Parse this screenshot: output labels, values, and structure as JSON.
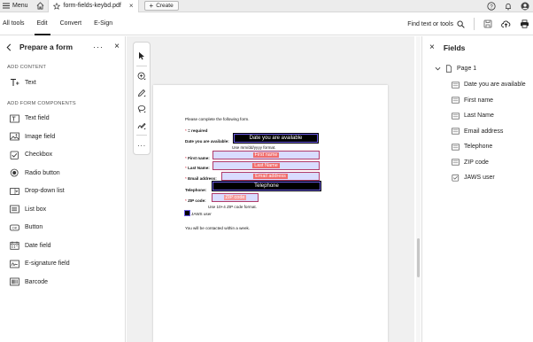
{
  "tabbar": {
    "menu_label": "Menu",
    "doc_tab_name": "form-fields-keybd.pdf",
    "create_label": "Create"
  },
  "toolbar": {
    "tabs": [
      {
        "label": "All tools",
        "active": false
      },
      {
        "label": "Edit",
        "active": true
      },
      {
        "label": "Convert",
        "active": false
      },
      {
        "label": "E-Sign",
        "active": false
      }
    ],
    "find_label": "Find text or tools"
  },
  "left_panel": {
    "title": "Prepare a form",
    "add_content_heading": "ADD CONTENT",
    "add_content_items": [
      {
        "label": "Text",
        "icon": "text-icon"
      }
    ],
    "components_heading": "ADD FORM COMPONENTS",
    "components": [
      {
        "label": "Text field",
        "icon": "text-field-icon"
      },
      {
        "label": "Image field",
        "icon": "image-field-icon"
      },
      {
        "label": "Checkbox",
        "icon": "checkbox-icon"
      },
      {
        "label": "Radio button",
        "icon": "radio-button-icon"
      },
      {
        "label": "Drop-down list",
        "icon": "dropdown-list-icon"
      },
      {
        "label": "List box",
        "icon": "list-box-icon"
      },
      {
        "label": "Button",
        "icon": "button-icon"
      },
      {
        "label": "Date field",
        "icon": "date-field-icon"
      },
      {
        "label": "E-signature field",
        "icon": "e-signature-icon"
      },
      {
        "label": "Barcode",
        "icon": "barcode-icon"
      }
    ]
  },
  "document": {
    "intro": "Please complete the following form.",
    "required_marker": "*",
    "required_note": " = required",
    "date_label": "Date you are available:",
    "date_field": "Date you are available",
    "date_hint": "Use mm/dd/yyyy format.",
    "first_name_label": "First name:",
    "first_name_field": "First name",
    "last_name_label": "Last Name:",
    "last_name_field": "Last Name",
    "email_label": "Email address:",
    "email_field": "Email address",
    "telephone_label": "Telephone:",
    "telephone_field": "Telephone",
    "zip_label": "ZIP code:",
    "zip_field": "ZIP code",
    "zip_hint": "Use 10+4 ZIP code format.",
    "jaws_label": "JAWS user",
    "closing": "You will be contacted within a week."
  },
  "right_panel": {
    "title": "Fields",
    "page_label": "Page 1",
    "fields": [
      {
        "label": "Date you are available",
        "icon": "text-field-icon"
      },
      {
        "label": "First name",
        "icon": "text-field-icon"
      },
      {
        "label": "Last Name",
        "icon": "text-field-icon"
      },
      {
        "label": "Email address",
        "icon": "text-field-icon"
      },
      {
        "label": "Telephone",
        "icon": "text-field-icon"
      },
      {
        "label": "ZIP code",
        "icon": "text-field-icon"
      },
      {
        "label": "JAWS user",
        "icon": "checkbox-icon"
      }
    ]
  },
  "colors": {
    "required": "#d0021b",
    "field_fill": "#d9dcff",
    "field_label_fill": "#ef6b6b",
    "selected_field": "#000000"
  }
}
